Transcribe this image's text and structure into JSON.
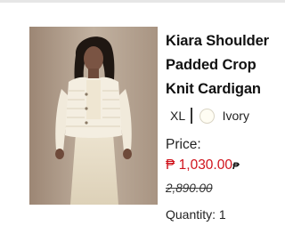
{
  "product": {
    "title_lines": [
      "Kiara Shoulder",
      "Padded Crop",
      "Knit Cardigan"
    ],
    "image_icon": "product-photo-woman-in-ivory-knit-cardigan",
    "variant": {
      "size": "XL",
      "divider": "|",
      "color_swatch": "#fffdf3",
      "color_name": "Ivory"
    },
    "price_label": "Price:",
    "price_current": "₱ 1,030.00",
    "price_currency_suffix": "₱",
    "price_original": "2,890.00",
    "quantity_text": "Quantity: 1"
  },
  "colors": {
    "price_red": "#d0121b",
    "text": "#1a1a1a"
  }
}
